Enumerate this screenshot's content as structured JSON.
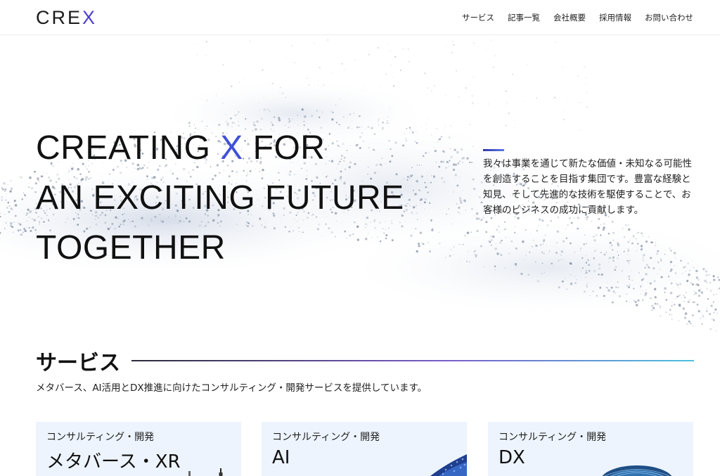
{
  "header": {
    "logo": {
      "prefix": "CRE",
      "accent": "X"
    },
    "nav": [
      "サービス",
      "記事一覧",
      "会社概要",
      "採用情報",
      "お問い合わせ"
    ]
  },
  "hero": {
    "headline": {
      "line1_pre": "CREATING ",
      "line1_x": "X",
      "line1_post": " FOR",
      "line2": "AN EXCITING FUTURE",
      "line3": "TOGETHER"
    },
    "intro": "我々は事業を通じて新たな価値・未知なる可能性を創造することを目指す集団です。豊富な経験と知見、そして先進的な技術を駆使することで、お客様のビジネスの成功に貢献します。"
  },
  "services": {
    "title": "サービス",
    "description": "メタバース、AI活用とDX推進に向けたコンサルティング・開発サービスを提供しています。",
    "cards": [
      {
        "category": "コンサルティング・開発",
        "title": "メタバース・XR"
      },
      {
        "category": "コンサルティング・開発",
        "title": "AI"
      },
      {
        "category": "コンサルティング・開発",
        "title": "DX"
      }
    ]
  },
  "colors": {
    "accent": "#4050d8",
    "card_bg": "#edf4fd",
    "line_gradient": [
      "#2a2a3a",
      "#7a5cc8",
      "#4ec0dc"
    ]
  }
}
